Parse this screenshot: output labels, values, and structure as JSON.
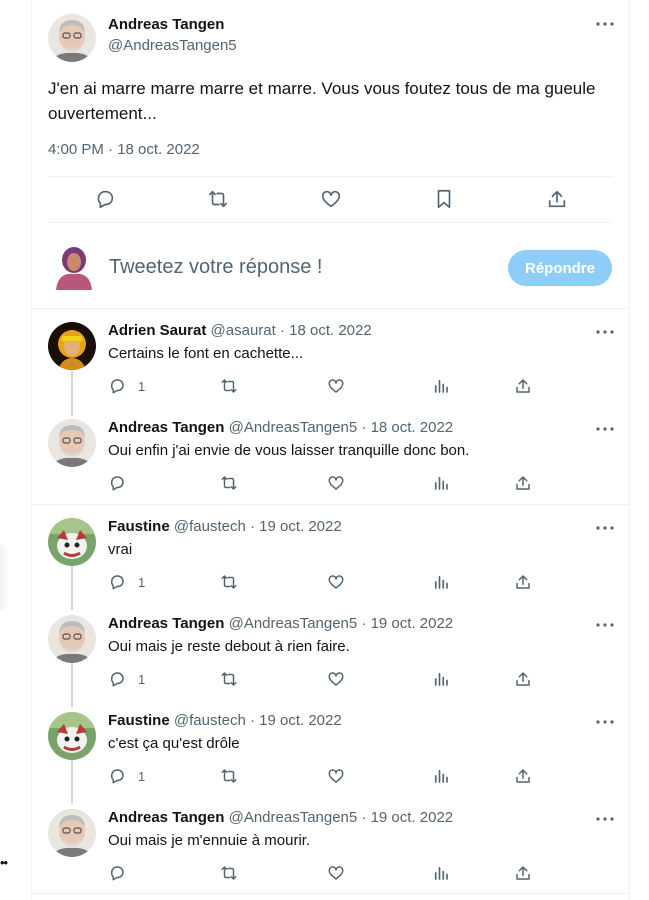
{
  "main_tweet": {
    "author_name": "Andreas Tangen",
    "author_handle": "@AndreasTangen5",
    "text": "J'en ai marre marre marre et marre. Vous vous foutez tous de ma gueule ouvertement...",
    "timestamp": "4:00 PM · 18 oct. 2022",
    "actions": [
      "reply-icon",
      "retweet-icon",
      "like-icon",
      "bookmark-icon",
      "share-icon"
    ]
  },
  "composer": {
    "placeholder": "Tweetez votre réponse !",
    "button_label": "Répondre"
  },
  "replies": [
    {
      "name": "Adrien Saurat",
      "meta": "@asaurat · 18 oct. 2022",
      "text": "Certains le font en cachette...",
      "reply_count": "1"
    },
    {
      "name": "Andreas Tangen",
      "meta": "@AndreasTangen5 · 18 oct. 2022",
      "text": "Oui enfin j'ai envie de vous laisser tranquille donc bon.",
      "reply_count": ""
    },
    {
      "name": "Faustine",
      "meta": "@faustech · 19 oct. 2022",
      "text": "vrai",
      "reply_count": "1"
    },
    {
      "name": "Andreas Tangen",
      "meta": "@AndreasTangen5 · 19 oct. 2022",
      "text": "Oui mais je reste debout à rien faire.",
      "reply_count": "1"
    },
    {
      "name": "Faustine",
      "meta": "@faustech · 19 oct. 2022",
      "text": "c'est ça qu'est drôle",
      "reply_count": "1"
    },
    {
      "name": "Andreas Tangen",
      "meta": "@AndreasTangen5 · 19 oct. 2022",
      "text": "Oui mais je m'ennuie à mourir.",
      "reply_count": ""
    }
  ],
  "colors": {
    "text": "#0f1419",
    "secondary": "#536471",
    "accent_disabled": "#8ecdf8",
    "border": "#eff3f4"
  }
}
